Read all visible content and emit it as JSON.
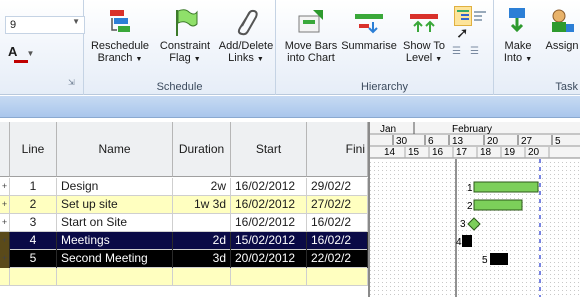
{
  "ribbon": {
    "font_size": "9",
    "font_color_label": "A",
    "groups": {
      "schedule": "Schedule",
      "hierarchy": "Hierarchy",
      "tasks": "Task"
    },
    "buttons": {
      "reschedule": [
        "Reschedule",
        "Branch"
      ],
      "constraint": [
        "Constraint",
        "Flag"
      ],
      "add_delete_links": [
        "Add/Delete",
        "Links"
      ],
      "move_bars": [
        "Move Bars",
        "into Chart"
      ],
      "summarise": [
        "Summarise",
        ""
      ],
      "show_to_level": [
        "Show To",
        "Level"
      ],
      "make_into": [
        "Make",
        "Into"
      ],
      "assign": [
        "Assign",
        ""
      ]
    }
  },
  "grid": {
    "headers": [
      "Line",
      "Name",
      "Duration",
      "Start",
      "Fini"
    ],
    "rows": [
      {
        "line": "1",
        "name": "Design",
        "duration": "2w",
        "start": "16/02/2012",
        "finish": "29/02/2",
        "style": "normal",
        "expand": "+"
      },
      {
        "line": "2",
        "name": "Set up site",
        "duration": "1w 3d",
        "start": "16/02/2012",
        "finish": "27/02/2",
        "style": "yellow",
        "expand": "+"
      },
      {
        "line": "3",
        "name": "Start on Site",
        "duration": "",
        "start": "16/02/2012",
        "finish": "16/02/2",
        "style": "normal",
        "expand": "+"
      },
      {
        "line": "4",
        "name": "Meetings",
        "duration": "2d",
        "start": "15/02/2012",
        "finish": "16/02/2",
        "style": "navy",
        "expand": "+"
      },
      {
        "line": "5",
        "name": "Second Meeting",
        "duration": "3d",
        "start": "20/02/2012",
        "finish": "22/02/2",
        "style": "black",
        "expand": "+"
      },
      {
        "line": "",
        "name": "",
        "duration": "",
        "start": "",
        "finish": "",
        "style": "yellowblank",
        "expand": ""
      }
    ]
  },
  "gantt": {
    "months": [
      "Jan",
      "February"
    ],
    "weeks": [
      "30",
      "6",
      "13",
      "20",
      "27",
      "5"
    ],
    "days": [
      "14",
      "15",
      "16",
      "17",
      "18",
      "19",
      "20"
    ],
    "bar_labels": [
      "1",
      "2",
      "3",
      "4",
      "5"
    ]
  },
  "colors": {
    "green_bar": "#7ccf5a",
    "diamond": "#7ccf5a",
    "navy_row": "#0a0a46",
    "yellow_row": "#ffffc0",
    "today_line": "#4b5bd8"
  }
}
